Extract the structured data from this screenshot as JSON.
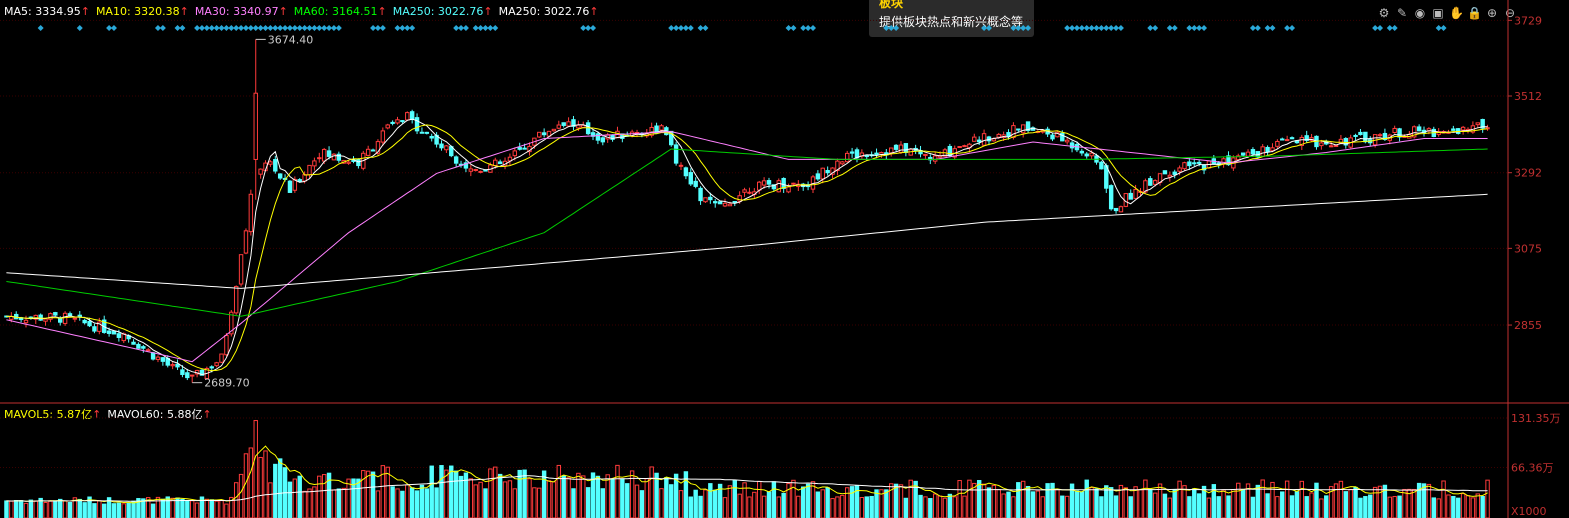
{
  "colors": {
    "up": "#ff3b3b",
    "down": "#54ffff",
    "ma5": "#ffffff",
    "ma10": "#ffff00",
    "ma30": "#ff80ff",
    "ma60": "#00cc00",
    "ma250": "#ffffff",
    "axis": "#c03030"
  },
  "ma_legend": [
    {
      "text": "MA5: 3334.95",
      "arrow": "↑",
      "color": "#ffffff"
    },
    {
      "text": "MA10: 3320.38",
      "arrow": "↑",
      "color": "#ffff00"
    },
    {
      "text": "MA30: 3340.97",
      "arrow": "↑",
      "color": "#ff80ff"
    },
    {
      "text": "MA60: 3164.51",
      "arrow": "↑",
      "color": "#00ff00"
    },
    {
      "text": "MA250: 3022.76",
      "arrow": "↑",
      "color": "#54ffff"
    },
    {
      "text": "MA250: 3022.76",
      "arrow": "↑",
      "color": "#ffffff"
    }
  ],
  "vol_legend": [
    {
      "text": "MAVOL5: 5.87亿",
      "arrow": "↑",
      "color": "#ffff00"
    },
    {
      "text": "MAVOL60: 5.88亿",
      "arrow": "↑",
      "color": "#ffffff"
    }
  ],
  "tooltip": {
    "title": "板块",
    "text": "提供板块热点和新兴概念等"
  },
  "toolbar_icons": [
    "gear-icon",
    "pen-icon",
    "eye-icon",
    "box-icon",
    "hand-icon",
    "lock-icon",
    "plus-icon",
    "minus-icon"
  ],
  "chart_data": {
    "type": "candlestick",
    "price_ticks": [
      "3729",
      "3512",
      "3292",
      "3075",
      "2855"
    ],
    "price_tick_values": [
      3729,
      3512,
      3292,
      3075,
      2855
    ],
    "ylim": [
      2640,
      3730
    ],
    "volume_ticks": [
      "131.35万",
      "66.36万",
      "X1000"
    ],
    "volume_tick_values": [
      131.35,
      66.36,
      0
    ],
    "vol_ylim": [
      0,
      131.35
    ],
    "annotations": [
      {
        "text": "3674.40",
        "value": 3674.4,
        "index": 51
      },
      {
        "text": "2689.70",
        "value": 2689.7,
        "index": 38
      }
    ],
    "anchors": [
      [
        0,
        2880
      ],
      [
        12,
        2875
      ],
      [
        24,
        2830
      ],
      [
        34,
        2730
      ],
      [
        38,
        2700
      ],
      [
        44,
        2760
      ],
      [
        48,
        3050
      ],
      [
        51,
        3300
      ],
      [
        54,
        3320
      ],
      [
        58,
        3240
      ],
      [
        64,
        3350
      ],
      [
        72,
        3320
      ],
      [
        78,
        3420
      ],
      [
        82,
        3450
      ],
      [
        88,
        3380
      ],
      [
        95,
        3300
      ],
      [
        102,
        3320
      ],
      [
        108,
        3390
      ],
      [
        114,
        3440
      ],
      [
        122,
        3390
      ],
      [
        130,
        3410
      ],
      [
        134,
        3420
      ],
      [
        138,
        3300
      ],
      [
        142,
        3220
      ],
      [
        146,
        3190
      ],
      [
        152,
        3250
      ],
      [
        158,
        3260
      ],
      [
        164,
        3260
      ],
      [
        170,
        3330
      ],
      [
        176,
        3350
      ],
      [
        184,
        3360
      ],
      [
        190,
        3330
      ],
      [
        196,
        3380
      ],
      [
        202,
        3400
      ],
      [
        208,
        3420
      ],
      [
        214,
        3400
      ],
      [
        220,
        3360
      ],
      [
        224,
        3310
      ],
      [
        226,
        3180
      ],
      [
        230,
        3230
      ],
      [
        236,
        3290
      ],
      [
        242,
        3310
      ],
      [
        248,
        3320
      ],
      [
        256,
        3350
      ],
      [
        262,
        3380
      ],
      [
        270,
        3380
      ],
      [
        278,
        3390
      ],
      [
        286,
        3410
      ],
      [
        294,
        3410
      ],
      [
        300,
        3420
      ],
      [
        303,
        3430
      ]
    ],
    "ma250_line": [
      [
        0,
        3005
      ],
      [
        48,
        2960
      ],
      [
        100,
        3020
      ],
      [
        150,
        3080
      ],
      [
        200,
        3150
      ],
      [
        303,
        3230
      ]
    ],
    "ma60_line": [
      [
        0,
        2980
      ],
      [
        48,
        2880
      ],
      [
        80,
        2980
      ],
      [
        110,
        3120
      ],
      [
        136,
        3360
      ],
      [
        170,
        3330
      ],
      [
        220,
        3330
      ],
      [
        260,
        3340
      ],
      [
        303,
        3360
      ]
    ],
    "ma30_line": [
      [
        0,
        2870
      ],
      [
        38,
        2750
      ],
      [
        48,
        2860
      ],
      [
        70,
        3120
      ],
      [
        88,
        3290
      ],
      [
        110,
        3390
      ],
      [
        136,
        3410
      ],
      [
        160,
        3330
      ],
      [
        190,
        3330
      ],
      [
        210,
        3380
      ],
      [
        230,
        3350
      ],
      [
        250,
        3320
      ],
      [
        270,
        3350
      ],
      [
        290,
        3390
      ],
      [
        303,
        3390
      ]
    ],
    "upper_marks_indices": [
      7,
      15,
      21,
      22,
      31,
      32,
      35,
      36,
      39,
      40,
      41,
      42,
      43,
      44,
      45,
      46,
      47,
      48,
      49,
      50,
      51,
      52,
      53,
      54,
      55,
      56,
      57,
      58,
      59,
      60,
      61,
      62,
      63,
      64,
      65,
      66,
      67,
      68,
      75,
      76,
      77,
      80,
      81,
      82,
      83,
      92,
      93,
      94,
      96,
      97,
      98,
      99,
      100,
      118,
      119,
      120,
      136,
      137,
      138,
      139,
      140,
      142,
      143,
      160,
      161,
      163,
      164,
      165,
      180,
      181,
      182,
      200,
      201,
      206,
      207,
      208,
      209,
      217,
      218,
      219,
      220,
      221,
      222,
      223,
      224,
      225,
      226,
      227,
      228,
      234,
      235,
      238,
      239,
      242,
      243,
      244,
      245,
      255,
      256,
      258,
      259,
      262,
      263,
      280,
      281,
      283,
      284,
      293,
      294
    ]
  }
}
